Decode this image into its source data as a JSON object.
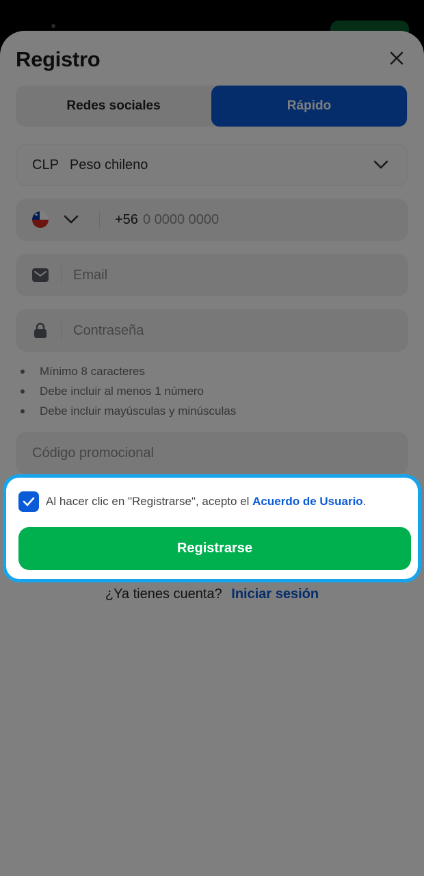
{
  "dialog": {
    "title": "Registro"
  },
  "tabs": [
    {
      "label": "Redes sociales",
      "active": false
    },
    {
      "label": "Rápido",
      "active": true
    }
  ],
  "currency": {
    "code": "CLP",
    "name": "Peso chileno"
  },
  "phone": {
    "country_code": "+56",
    "placeholder": "0 0000 0000",
    "flag": "chile-flag-icon"
  },
  "email": {
    "placeholder": "Email"
  },
  "password": {
    "placeholder": "Contraseña"
  },
  "password_rules": [
    "Mínimo 8 caracteres",
    "Debe incluir al menos 1 número",
    "Debe incluir mayúsculas y minúsculas"
  ],
  "promo": {
    "placeholder": "Código promocional"
  },
  "agreement": {
    "checked": true,
    "text": "Al hacer clic en \"Registrarse\", acepto el ",
    "link": "Acuerdo de Usuario",
    "suffix": "."
  },
  "register_button": "Registrarse",
  "login": {
    "question": "¿Ya tienes cuenta?",
    "link": "Iniciar sesión"
  },
  "colors": {
    "primary_blue": "#0a5bd8",
    "register_green": "#00b04f",
    "highlight_border": "#16a5ec"
  }
}
